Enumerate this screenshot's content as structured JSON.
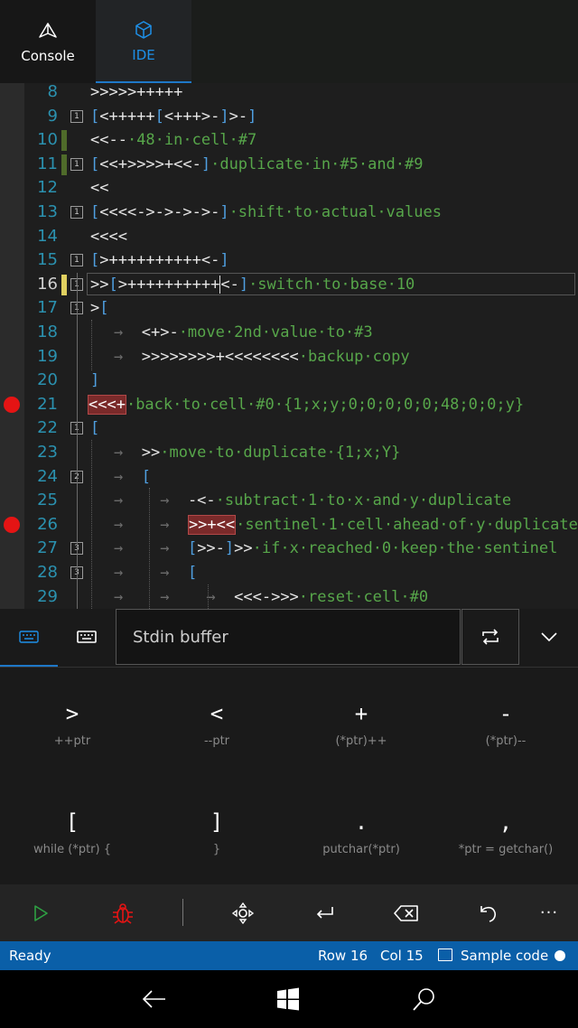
{
  "tabs": [
    {
      "label": "Console",
      "icon": "console-prism-icon"
    },
    {
      "label": "IDE",
      "icon": "ide-cube-icon"
    }
  ],
  "editor": {
    "lines": [
      {
        "n": "8"
      },
      {
        "n": "9"
      },
      {
        "n": "10"
      },
      {
        "n": "11"
      },
      {
        "n": "12"
      },
      {
        "n": "13"
      },
      {
        "n": "14"
      },
      {
        "n": "15"
      },
      {
        "n": "16"
      },
      {
        "n": "17"
      },
      {
        "n": "18"
      },
      {
        "n": "19"
      },
      {
        "n": "20"
      },
      {
        "n": "21"
      },
      {
        "n": "22"
      },
      {
        "n": "23"
      },
      {
        "n": "24"
      },
      {
        "n": "25"
      },
      {
        "n": "26"
      },
      {
        "n": "27"
      },
      {
        "n": "28"
      },
      {
        "n": "29"
      }
    ],
    "code": {
      "l8": ">>>>>+++++",
      "l9a": "[",
      "l9b": "<+++++",
      "l9c": "[",
      "l9d": "<+++>-",
      "l9e": "]",
      "l9f": ">-",
      "l9g": "]",
      "l10a": "<<--",
      "l10b": "·48·in·cell·#7",
      "l11a": "[",
      "l11b": "<<+>>>>+<<-",
      "l11c": "]",
      "l11d": "·duplicate·in·#5·and·#9",
      "l12": "<<",
      "l13a": "[",
      "l13b": "<<<<->->->->-",
      "l13c": "]",
      "l13d": "·shift·to·actual·values",
      "l14": "<<<<",
      "l15a": "[",
      "l15b": ">++++++++++<-",
      "l15c": "]",
      "l16a": ">>",
      "l16b": "[",
      "l16c": ">++++++++++",
      "l16d": "<-",
      "l16e": "]",
      "l16f": "·switch·to·base·10",
      "l17a": ">",
      "l17b": "[",
      "l18a": "<+>-",
      "l18b": "·move·2nd·value·to·#3",
      "l19a": ">>>>>>>>+<<<<<<<<",
      "l19b": "·backup·copy",
      "l20": "]",
      "l21a": "<<<+",
      "l21b": "·back·to·cell·#0·{1;x;y;0;0;0;0;0;48;0;0;y}",
      "l22": "[",
      "l23a": ">>",
      "l23b": "·move·to·duplicate·{1;x;Y}",
      "l24": "[",
      "l25a": "-<-",
      "l25b": "·subtract·1·to·x·and·y·duplicate",
      "l26a": ">>+<<",
      "l26b": "·sentinel·1·cell·ahead·of·y·duplicate",
      "l27a": "[",
      "l27b": ">>-",
      "l27c": "]",
      "l27d": ">>",
      "l27e": "·if·x·reached·0·keep·the·sentinel",
      "l28": "[",
      "l29a": "<<<->>>",
      "l29b": "·reset·cell·#0",
      "arrow": "→",
      "dot": "·"
    },
    "folds": {
      "f9": "1",
      "f11": "1",
      "f13": "1",
      "f15": "1",
      "f16": "1",
      "f17": "1",
      "f22": "1",
      "f24": "2",
      "f27": "3",
      "f28": "3"
    }
  },
  "stdin": {
    "placeholder": "Stdin buffer",
    "keyboard_tab": "keyboard-icon",
    "hw_keyboard_tab": "hardware-keyboard-icon"
  },
  "keypad": [
    {
      "symbol": ">",
      "desc": "++ptr"
    },
    {
      "symbol": "<",
      "desc": "--ptr"
    },
    {
      "symbol": "+",
      "desc": "(*ptr)++"
    },
    {
      "symbol": "-",
      "desc": "(*ptr)--"
    },
    {
      "symbol": "[",
      "desc": "while (*ptr) {"
    },
    {
      "symbol": "]",
      "desc": "}"
    },
    {
      "symbol": ".",
      "desc": "putchar(*ptr)"
    },
    {
      "symbol": ",",
      "desc": "*ptr = getchar()"
    }
  ],
  "toolbar": {
    "icons": [
      "play-icon",
      "debug-bug-icon",
      "cursor-move-icon",
      "enter-icon",
      "backspace-icon",
      "undo-icon",
      "more-icon"
    ],
    "more_label": "···"
  },
  "status": {
    "state": "Ready",
    "row": "Row 16",
    "col": "Col 15",
    "file": "Sample code"
  },
  "colors": {
    "accent": "#1e78c8",
    "status_bar": "#0a5fa8",
    "comment": "#57a64a",
    "bracket": "#4f9fe0",
    "breakpoint": "#e51414",
    "play": "#2ea043",
    "debug": "#e51414"
  }
}
